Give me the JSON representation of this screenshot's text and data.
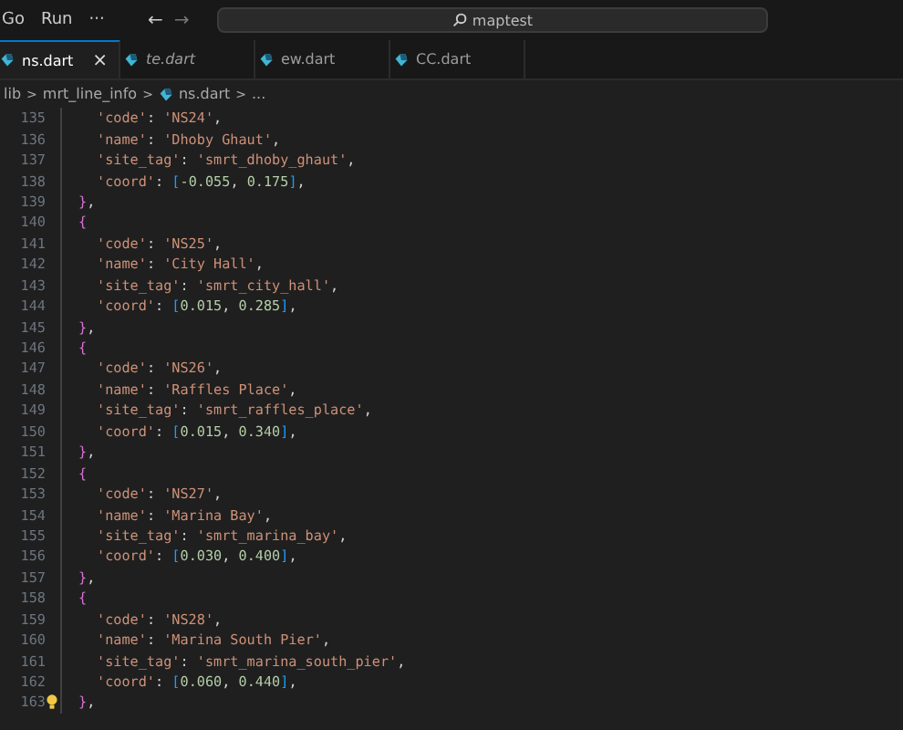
{
  "menu": [
    "Go",
    "Run",
    "···"
  ],
  "nav": {
    "back": "←",
    "forward": "→"
  },
  "search": {
    "value": "maptest"
  },
  "tabs": [
    {
      "label": "ns.dart",
      "selected": true,
      "preview": false,
      "close": "×"
    },
    {
      "label": "te.dart",
      "selected": false,
      "preview": true
    },
    {
      "label": "ew.dart",
      "selected": false,
      "preview": false
    },
    {
      "label": "CC.dart",
      "selected": false,
      "preview": false
    }
  ],
  "breadcrumb": [
    {
      "label": "lib",
      "kind": "folder"
    },
    {
      "label": ">",
      "kind": "sep"
    },
    {
      "label": "mrt_line_info",
      "kind": "folder"
    },
    {
      "label": ">",
      "kind": "sep"
    },
    {
      "label": "ns.dart",
      "kind": "file"
    },
    {
      "label": ">",
      "kind": "sep"
    },
    {
      "label": "...",
      "kind": "folder"
    }
  ],
  "lines": [
    {
      "number": "135",
      "kind": "field",
      "tokens": [
        {
          "t": "'code'",
          "kind": "string"
        },
        {
          "t": ": ",
          "kind": "punct"
        },
        {
          "t": "'NS24'",
          "kind": "string"
        },
        {
          "t": ",",
          "kind": "punct"
        }
      ]
    },
    {
      "number": "136",
      "kind": "field",
      "tokens": [
        {
          "t": "'name'",
          "kind": "string"
        },
        {
          "t": ": ",
          "kind": "punct"
        },
        {
          "t": "'Dhoby Ghaut'",
          "kind": "string"
        },
        {
          "t": ",",
          "kind": "punct"
        }
      ]
    },
    {
      "number": "137",
      "kind": "field",
      "tokens": [
        {
          "t": "'site_tag'",
          "kind": "string"
        },
        {
          "t": ": ",
          "kind": "punct"
        },
        {
          "t": "'smrt_dhoby_ghaut'",
          "kind": "string"
        },
        {
          "t": ",",
          "kind": "punct"
        }
      ]
    },
    {
      "number": "138",
      "kind": "field",
      "tokens": [
        {
          "t": "'coord'",
          "kind": "string"
        },
        {
          "t": ": ",
          "kind": "punct"
        },
        {
          "t": "[",
          "kind": "bracket"
        },
        {
          "t": "-0.055",
          "kind": "number"
        },
        {
          "t": ", ",
          "kind": "punct"
        },
        {
          "t": "0.175",
          "kind": "number"
        },
        {
          "t": "]",
          "kind": "bracket"
        },
        {
          "t": ",",
          "kind": "punct"
        }
      ]
    },
    {
      "number": "139",
      "kind": "brace",
      "tokens": [
        {
          "t": "}",
          "kind": "brace"
        },
        {
          "t": ",",
          "kind": "punct"
        }
      ]
    },
    {
      "number": "140",
      "kind": "brace",
      "tokens": [
        {
          "t": "{",
          "kind": "brace"
        }
      ]
    },
    {
      "number": "141",
      "kind": "field",
      "tokens": [
        {
          "t": "'code'",
          "kind": "string"
        },
        {
          "t": ": ",
          "kind": "punct"
        },
        {
          "t": "'NS25'",
          "kind": "string"
        },
        {
          "t": ",",
          "kind": "punct"
        }
      ]
    },
    {
      "number": "142",
      "kind": "field",
      "tokens": [
        {
          "t": "'name'",
          "kind": "string"
        },
        {
          "t": ": ",
          "kind": "punct"
        },
        {
          "t": "'City Hall'",
          "kind": "string"
        },
        {
          "t": ",",
          "kind": "punct"
        }
      ]
    },
    {
      "number": "143",
      "kind": "field",
      "tokens": [
        {
          "t": "'site_tag'",
          "kind": "string"
        },
        {
          "t": ": ",
          "kind": "punct"
        },
        {
          "t": "'smrt_city_hall'",
          "kind": "string"
        },
        {
          "t": ",",
          "kind": "punct"
        }
      ]
    },
    {
      "number": "144",
      "kind": "field",
      "tokens": [
        {
          "t": "'coord'",
          "kind": "string"
        },
        {
          "t": ": ",
          "kind": "punct"
        },
        {
          "t": "[",
          "kind": "bracket"
        },
        {
          "t": "0.015",
          "kind": "number"
        },
        {
          "t": ", ",
          "kind": "punct"
        },
        {
          "t": "0.285",
          "kind": "number"
        },
        {
          "t": "]",
          "kind": "bracket"
        },
        {
          "t": ",",
          "kind": "punct"
        }
      ]
    },
    {
      "number": "145",
      "kind": "brace",
      "tokens": [
        {
          "t": "}",
          "kind": "brace"
        },
        {
          "t": ",",
          "kind": "punct"
        }
      ]
    },
    {
      "number": "146",
      "kind": "brace",
      "tokens": [
        {
          "t": "{",
          "kind": "brace"
        }
      ]
    },
    {
      "number": "147",
      "kind": "field",
      "tokens": [
        {
          "t": "'code'",
          "kind": "string"
        },
        {
          "t": ": ",
          "kind": "punct"
        },
        {
          "t": "'NS26'",
          "kind": "string"
        },
        {
          "t": ",",
          "kind": "punct"
        }
      ]
    },
    {
      "number": "148",
      "kind": "field",
      "tokens": [
        {
          "t": "'name'",
          "kind": "string"
        },
        {
          "t": ": ",
          "kind": "punct"
        },
        {
          "t": "'Raffles Place'",
          "kind": "string"
        },
        {
          "t": ",",
          "kind": "punct"
        }
      ]
    },
    {
      "number": "149",
      "kind": "field",
      "tokens": [
        {
          "t": "'site_tag'",
          "kind": "string"
        },
        {
          "t": ": ",
          "kind": "punct"
        },
        {
          "t": "'smrt_raffles_place'",
          "kind": "string"
        },
        {
          "t": ",",
          "kind": "punct"
        }
      ]
    },
    {
      "number": "150",
      "kind": "field",
      "tokens": [
        {
          "t": "'coord'",
          "kind": "string"
        },
        {
          "t": ": ",
          "kind": "punct"
        },
        {
          "t": "[",
          "kind": "bracket"
        },
        {
          "t": "0.015",
          "kind": "number"
        },
        {
          "t": ", ",
          "kind": "punct"
        },
        {
          "t": "0.340",
          "kind": "number"
        },
        {
          "t": "]",
          "kind": "bracket"
        },
        {
          "t": ",",
          "kind": "punct"
        }
      ]
    },
    {
      "number": "151",
      "kind": "brace",
      "tokens": [
        {
          "t": "}",
          "kind": "brace"
        },
        {
          "t": ",",
          "kind": "punct"
        }
      ]
    },
    {
      "number": "152",
      "kind": "brace",
      "tokens": [
        {
          "t": "{",
          "kind": "brace"
        }
      ]
    },
    {
      "number": "153",
      "kind": "field",
      "tokens": [
        {
          "t": "'code'",
          "kind": "string"
        },
        {
          "t": ": ",
          "kind": "punct"
        },
        {
          "t": "'NS27'",
          "kind": "string"
        },
        {
          "t": ",",
          "kind": "punct"
        }
      ]
    },
    {
      "number": "154",
      "kind": "field",
      "tokens": [
        {
          "t": "'name'",
          "kind": "string"
        },
        {
          "t": ": ",
          "kind": "punct"
        },
        {
          "t": "'Marina Bay'",
          "kind": "string"
        },
        {
          "t": ",",
          "kind": "punct"
        }
      ]
    },
    {
      "number": "155",
      "kind": "field",
      "tokens": [
        {
          "t": "'site_tag'",
          "kind": "string"
        },
        {
          "t": ": ",
          "kind": "punct"
        },
        {
          "t": "'smrt_marina_bay'",
          "kind": "string"
        },
        {
          "t": ",",
          "kind": "punct"
        }
      ]
    },
    {
      "number": "156",
      "kind": "field",
      "tokens": [
        {
          "t": "'coord'",
          "kind": "string"
        },
        {
          "t": ": ",
          "kind": "punct"
        },
        {
          "t": "[",
          "kind": "bracket"
        },
        {
          "t": "0.030",
          "kind": "number"
        },
        {
          "t": ", ",
          "kind": "punct"
        },
        {
          "t": "0.400",
          "kind": "number"
        },
        {
          "t": "]",
          "kind": "bracket"
        },
        {
          "t": ",",
          "kind": "punct"
        }
      ]
    },
    {
      "number": "157",
      "kind": "brace",
      "tokens": [
        {
          "t": "}",
          "kind": "brace"
        },
        {
          "t": ",",
          "kind": "punct"
        }
      ]
    },
    {
      "number": "158",
      "kind": "brace",
      "tokens": [
        {
          "t": "{",
          "kind": "brace"
        }
      ]
    },
    {
      "number": "159",
      "kind": "field",
      "tokens": [
        {
          "t": "'code'",
          "kind": "string"
        },
        {
          "t": ": ",
          "kind": "punct"
        },
        {
          "t": "'NS28'",
          "kind": "string"
        },
        {
          "t": ",",
          "kind": "punct"
        }
      ]
    },
    {
      "number": "160",
      "kind": "field",
      "tokens": [
        {
          "t": "'name'",
          "kind": "string"
        },
        {
          "t": ": ",
          "kind": "punct"
        },
        {
          "t": "'Marina South Pier'",
          "kind": "string"
        },
        {
          "t": ",",
          "kind": "punct"
        }
      ]
    },
    {
      "number": "161",
      "kind": "field",
      "tokens": [
        {
          "t": "'site_tag'",
          "kind": "string"
        },
        {
          "t": ": ",
          "kind": "punct"
        },
        {
          "t": "'smrt_marina_south_pier'",
          "kind": "string"
        },
        {
          "t": ",",
          "kind": "punct"
        }
      ]
    },
    {
      "number": "162",
      "kind": "field",
      "tokens": [
        {
          "t": "'coord'",
          "kind": "string"
        },
        {
          "t": ": ",
          "kind": "punct"
        },
        {
          "t": "[",
          "kind": "bracket"
        },
        {
          "t": "0.060",
          "kind": "number"
        },
        {
          "t": ", ",
          "kind": "punct"
        },
        {
          "t": "0.440",
          "kind": "number"
        },
        {
          "t": "]",
          "kind": "bracket"
        },
        {
          "t": ",",
          "kind": "punct"
        }
      ]
    },
    {
      "number": "163",
      "kind": "brace",
      "lightbulb": true,
      "tokens": [
        {
          "t": "}",
          "kind": "brace"
        },
        {
          "t": ",",
          "kind": "punct"
        }
      ]
    }
  ]
}
